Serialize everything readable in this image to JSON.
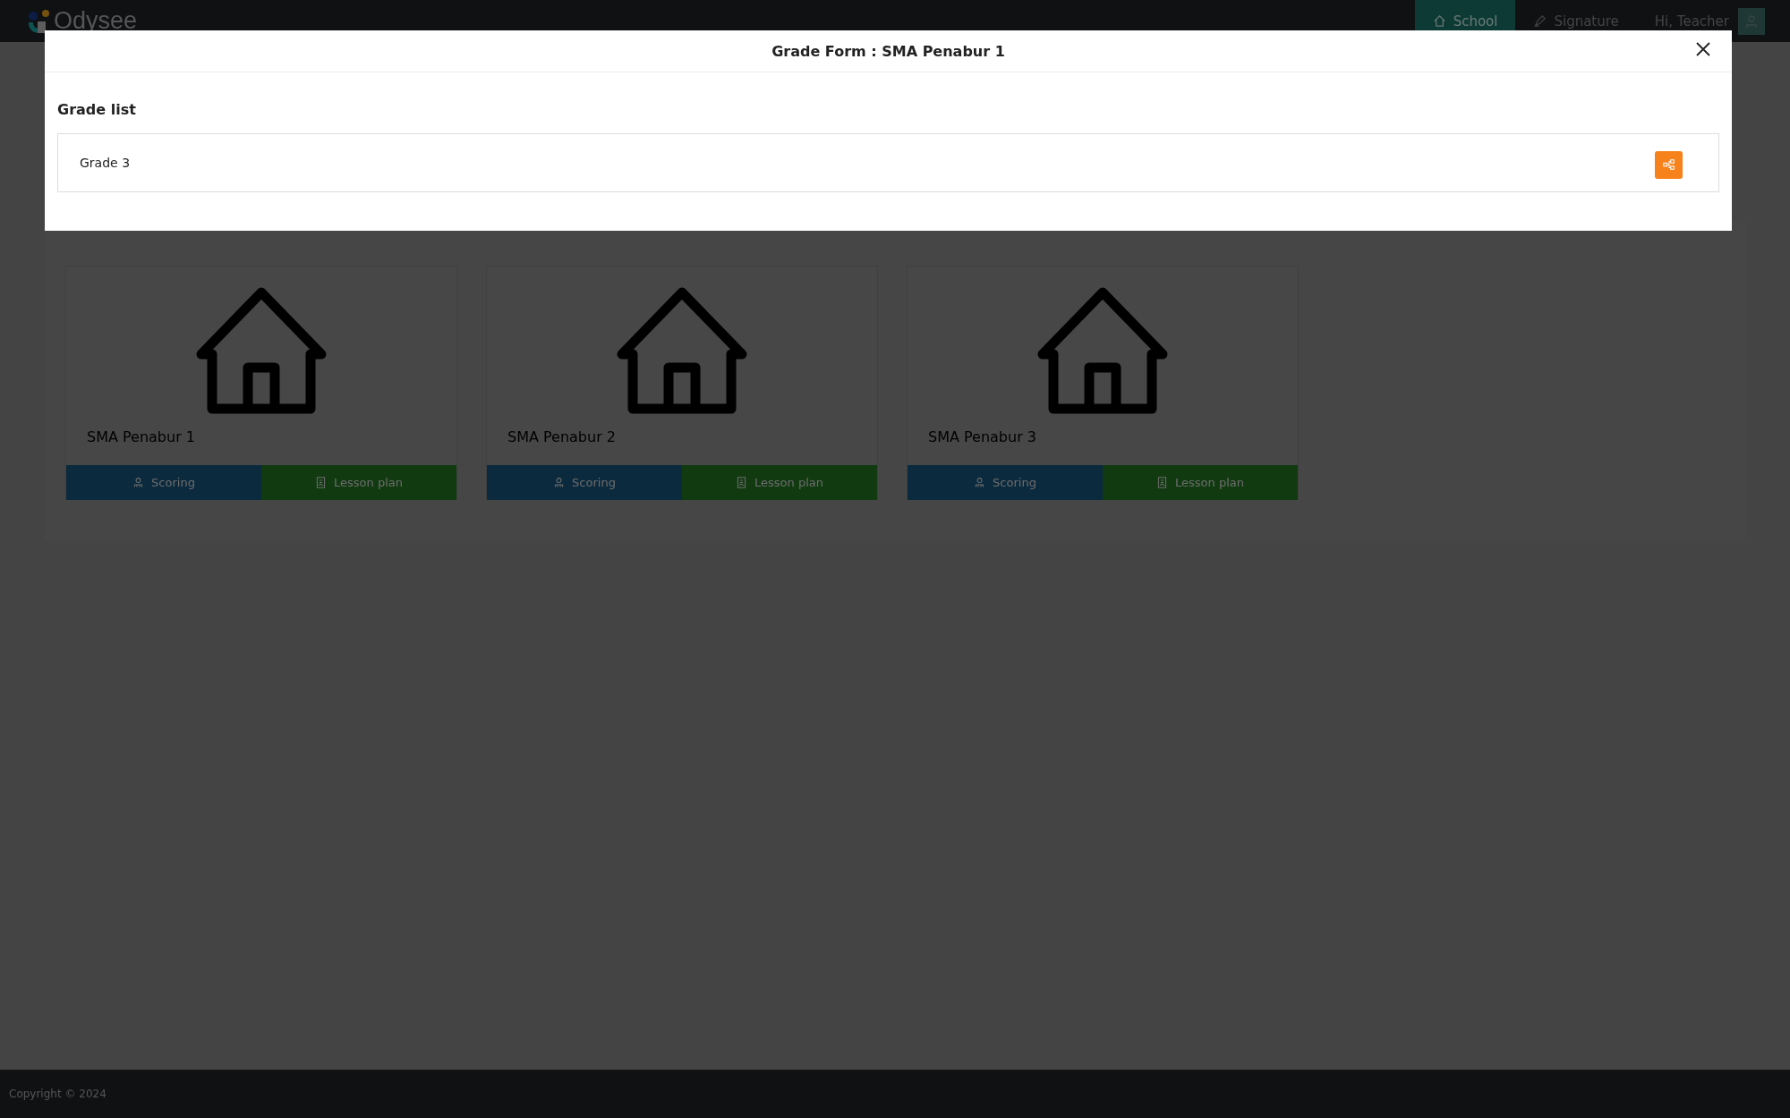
{
  "header": {
    "logo": "Odysee",
    "nav": [
      {
        "kind": "home",
        "label": "School",
        "selected": true
      },
      {
        "kind": "pen",
        "label": "Signature",
        "selected": false
      }
    ],
    "greeting": "Hi, Teacher"
  },
  "schools": [
    {
      "name": "SMA Penabur 1",
      "actions": [
        {
          "kind": "scoring",
          "label": "Scoring"
        },
        {
          "kind": "lesson",
          "label": "Lesson plan"
        }
      ]
    },
    {
      "name": "SMA Penabur 2",
      "actions": [
        {
          "kind": "scoring",
          "label": "Scoring"
        },
        {
          "kind": "lesson",
          "label": "Lesson plan"
        }
      ]
    },
    {
      "name": "SMA Penabur 3",
      "actions": [
        {
          "kind": "scoring",
          "label": "Scoring"
        },
        {
          "kind": "lesson",
          "label": "Lesson plan"
        }
      ]
    }
  ],
  "footer": {
    "copyright": "Copyright © 2024"
  },
  "modal": {
    "title": "Grade Form : SMA Penabur 1",
    "section_title": "Grade list",
    "grades": [
      {
        "label": "Grade 3"
      }
    ]
  }
}
